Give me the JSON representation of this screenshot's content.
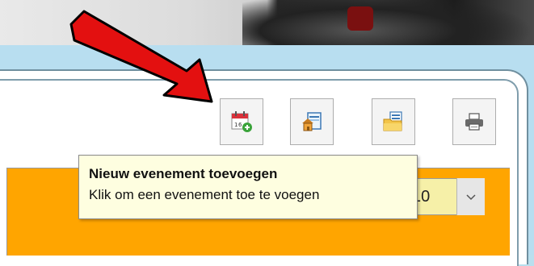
{
  "toolbar": {
    "buttons": [
      {
        "name": "new-event",
        "icon": "calendar-add-icon"
      },
      {
        "name": "home-page",
        "icon": "house-page-icon"
      },
      {
        "name": "folder",
        "icon": "folder-documents-icon"
      },
      {
        "name": "print",
        "icon": "printer-icon"
      }
    ]
  },
  "tooltip": {
    "title": "Nieuw evenement toevoegen",
    "description": "Klik om een evenement toe te voegen"
  },
  "select": {
    "value": "10"
  },
  "colors": {
    "frame": "#b8def0",
    "content_bg": "#ffa500",
    "tooltip_bg": "#fefee0",
    "select_bg": "#f6f0a8",
    "arrow": "#e31010"
  }
}
